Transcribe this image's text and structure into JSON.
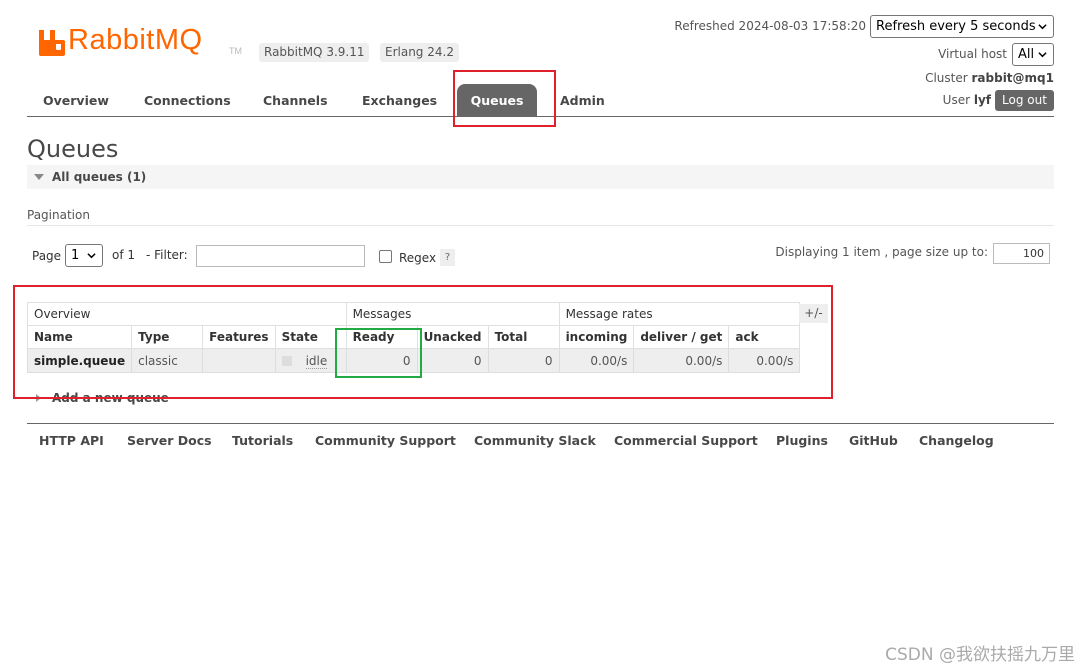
{
  "brand": {
    "logo_text": "RabbitMQ",
    "tm": "TM",
    "brand_color": "#ff6600"
  },
  "versions": {
    "rabbitmq": "RabbitMQ 3.9.11",
    "erlang": "Erlang 24.2"
  },
  "header": {
    "refreshed_label": "Refreshed 2024-08-03 17:58:20",
    "refresh_select": "Refresh every 5 seconds",
    "vhost_label": "Virtual host",
    "vhost_select": "All",
    "cluster_label": "Cluster",
    "cluster_name": "rabbit@mq1",
    "user_label": "User",
    "user_name": "lyf",
    "logout": "Log out"
  },
  "nav": {
    "items": [
      "Overview",
      "Connections",
      "Channels",
      "Exchanges",
      "Queues",
      "Admin"
    ],
    "active": "Queues"
  },
  "page": {
    "title": "Queues",
    "section": "All queues (1)",
    "pagination_label": "Pagination",
    "page_label": "Page",
    "page_value": "1",
    "of_label": "of 1",
    "filter_label": "- Filter:",
    "filter_value": "",
    "regex_label": "Regex",
    "help": "?",
    "displaying": "Displaying 1 item , page size up to:",
    "page_size": "100",
    "toggle_columns": "+/-",
    "add_queue": "Add a new queue"
  },
  "table": {
    "groups": [
      "Overview",
      "Messages",
      "Message rates"
    ],
    "columns": [
      "Name",
      "Type",
      "Features",
      "State",
      "Ready",
      "Unacked",
      "Total",
      "incoming",
      "deliver / get",
      "ack"
    ],
    "rows": [
      {
        "name": "simple.queue",
        "type": "classic",
        "features": "",
        "state": "idle",
        "ready": "0",
        "unacked": "0",
        "total": "0",
        "incoming": "0.00/s",
        "deliver_get": "0.00/s",
        "ack": "0.00/s"
      }
    ]
  },
  "footer": {
    "links": [
      "HTTP API",
      "Server Docs",
      "Tutorials",
      "Community Support",
      "Community Slack",
      "Commercial Support",
      "Plugins",
      "GitHub",
      "Changelog"
    ]
  },
  "annotations": {
    "red": "#e0202a",
    "green": "#22aa44"
  },
  "watermark": "CSDN @我欲扶摇九万里"
}
